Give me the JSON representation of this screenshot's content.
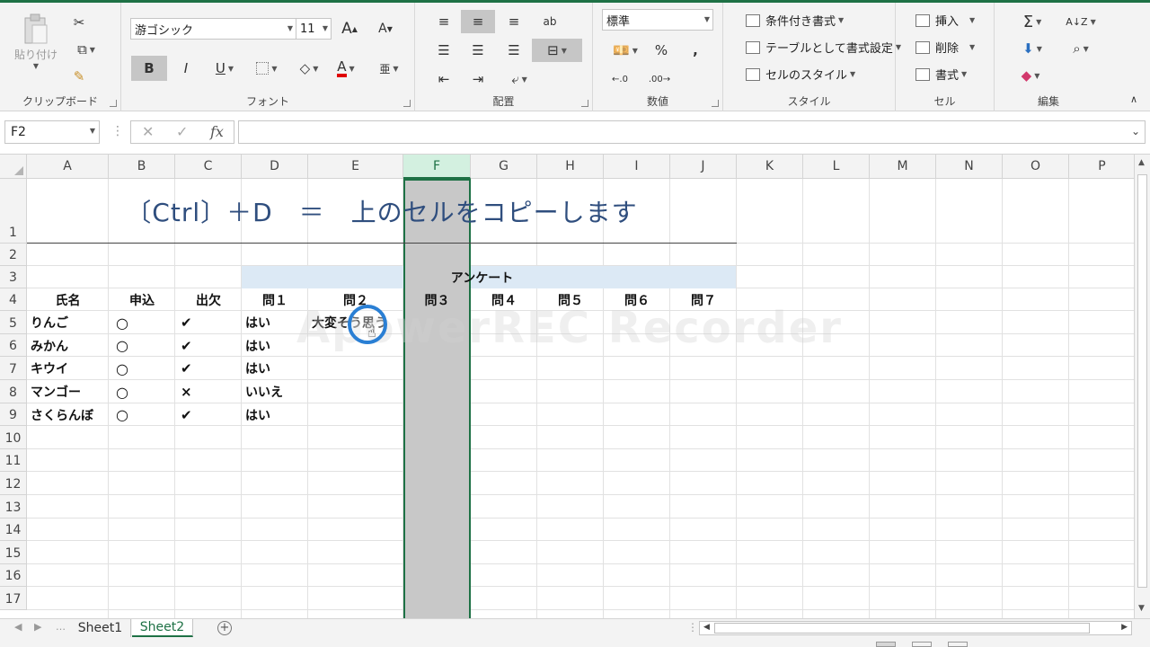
{
  "ribbon": {
    "clipboard": {
      "paste_label": "貼り付け",
      "group_label": "クリップボード"
    },
    "font": {
      "font_name": "游ゴシック",
      "font_size": "11",
      "bold": "B",
      "italic": "I",
      "underline": "U",
      "font_color_letter": "A",
      "group_label": "フォント"
    },
    "alignment": {
      "group_label": "配置"
    },
    "number": {
      "format": "標準",
      "percent": "%",
      "comma": ",",
      "group_label": "数値"
    },
    "styles": {
      "conditional": "条件付き書式",
      "table": "テーブルとして書式設定",
      "cell_styles": "セルのスタイル",
      "group_label": "スタイル"
    },
    "cells": {
      "insert": "挿入",
      "delete": "削除",
      "format": "書式",
      "group_label": "セル"
    },
    "editing": {
      "sum": "Σ",
      "group_label": "編集"
    }
  },
  "formula_bar": {
    "name_box": "F2",
    "fx": "fx",
    "cancel": "✕",
    "enter": "✓",
    "content": ""
  },
  "columns": [
    "A",
    "B",
    "C",
    "D",
    "E",
    "F",
    "G",
    "H",
    "I",
    "J",
    "K",
    "L",
    "M",
    "N",
    "O",
    "P"
  ],
  "rows": [
    "1",
    "2",
    "3",
    "4",
    "5",
    "6",
    "7",
    "8",
    "9",
    "10",
    "11",
    "12",
    "13",
    "14",
    "15",
    "16",
    "17"
  ],
  "sheet": {
    "title": "〔Ctrl〕＋D　＝　上のセルをコピーします",
    "survey_header": "アンケート",
    "headers": {
      "A": "氏名",
      "B": "申込",
      "C": "出欠",
      "D": "問１",
      "E": "問２",
      "F": "問３",
      "G": "問４",
      "H": "問５",
      "I": "問６",
      "J": "問７"
    },
    "data": [
      {
        "name": "りんご",
        "apply": "○",
        "attend": "✔",
        "q1": "はい",
        "q2": "大変そう思う"
      },
      {
        "name": "みかん",
        "apply": "○",
        "attend": "✔",
        "q1": "はい",
        "q2": ""
      },
      {
        "name": "キウイ",
        "apply": "○",
        "attend": "✔",
        "q1": "はい",
        "q2": ""
      },
      {
        "name": "マンゴー",
        "apply": "○",
        "attend": "×",
        "q1": "いいえ",
        "q2": ""
      },
      {
        "name": "さくらんぼ",
        "apply": "○",
        "attend": "✔",
        "q1": "はい",
        "q2": ""
      }
    ]
  },
  "watermark": "ApowerREC Recorder",
  "tabs": [
    "Sheet1",
    "Sheet2"
  ],
  "active_tab": "Sheet2",
  "colors": {
    "accent": "#1e7145",
    "title": "#2f4e7e",
    "band": "#dce9f5",
    "selection": "#c8c8c8"
  }
}
